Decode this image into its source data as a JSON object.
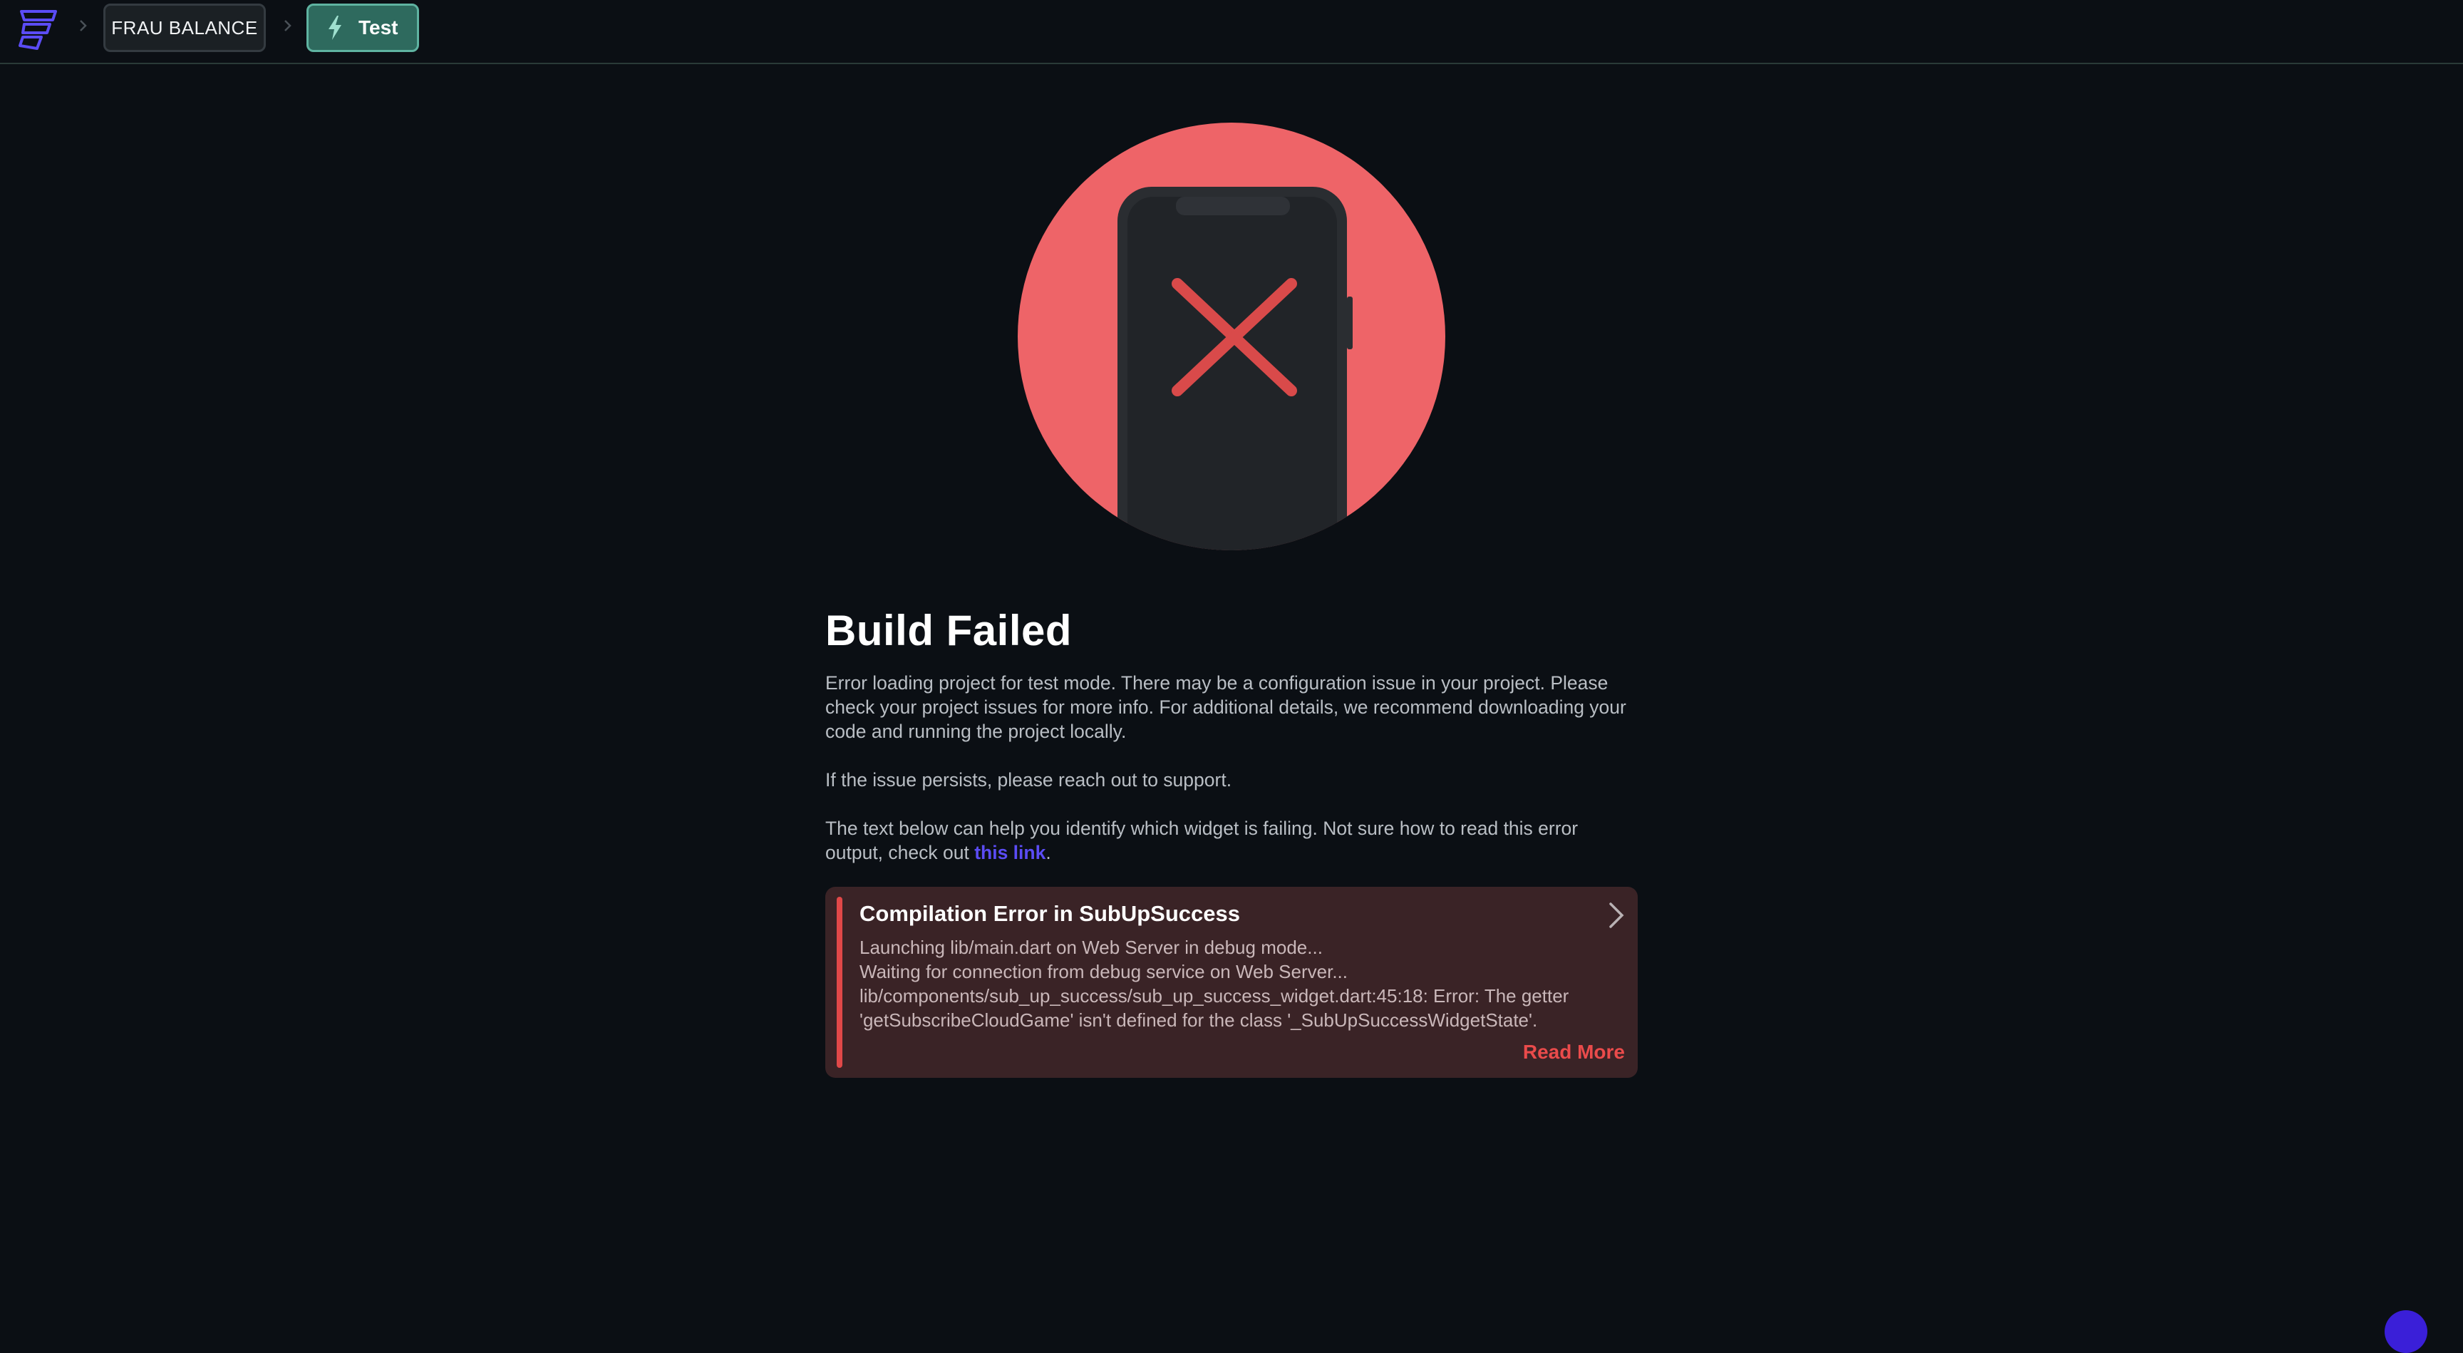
{
  "header": {
    "logo_icon": "flutterflow-logo-icon",
    "breadcrumbs": [
      {
        "label": "FRAU BALANCE",
        "icon": null
      },
      {
        "label": "Test",
        "icon": "lightning-bolt-icon"
      }
    ],
    "separator_icon": "chevron-right-icon"
  },
  "hero": {
    "illustration": "phone-with-x-icon",
    "circle_color": "#ee6468",
    "x_color": "#e04a4a"
  },
  "main": {
    "title": "Build Failed",
    "paragraph1": "Error loading project for test mode. There may be a configuration issue in your project. Please check your project issues for more info. For additional details, we recommend downloading your code and running the project locally.",
    "paragraph2": "If the issue persists, please reach out to support.",
    "paragraph3_prefix": "The text below can help you identify which widget is failing. Not sure how to read this error output, check out ",
    "paragraph3_link": "this link",
    "paragraph3_suffix": "."
  },
  "error_card": {
    "title": "Compilation Error in SubUpSuccess",
    "body": "Launching lib/main.dart on Web Server in debug mode...\nWaiting for connection from debug service on Web Server...\nlib/components/sub_up_success/sub_up_success_widget.dart:45:18: Error: The getter 'getSubscribeCloudGame' isn't defined for the class '_SubUpSuccessWidgetState'.",
    "read_more": "Read More",
    "expand_icon": "chevron-right-icon"
  },
  "colors": {
    "background": "#0b0f14",
    "accent_teal": "#2e6a5e",
    "link": "#5b4cf5",
    "error": "#ea4b4b"
  }
}
